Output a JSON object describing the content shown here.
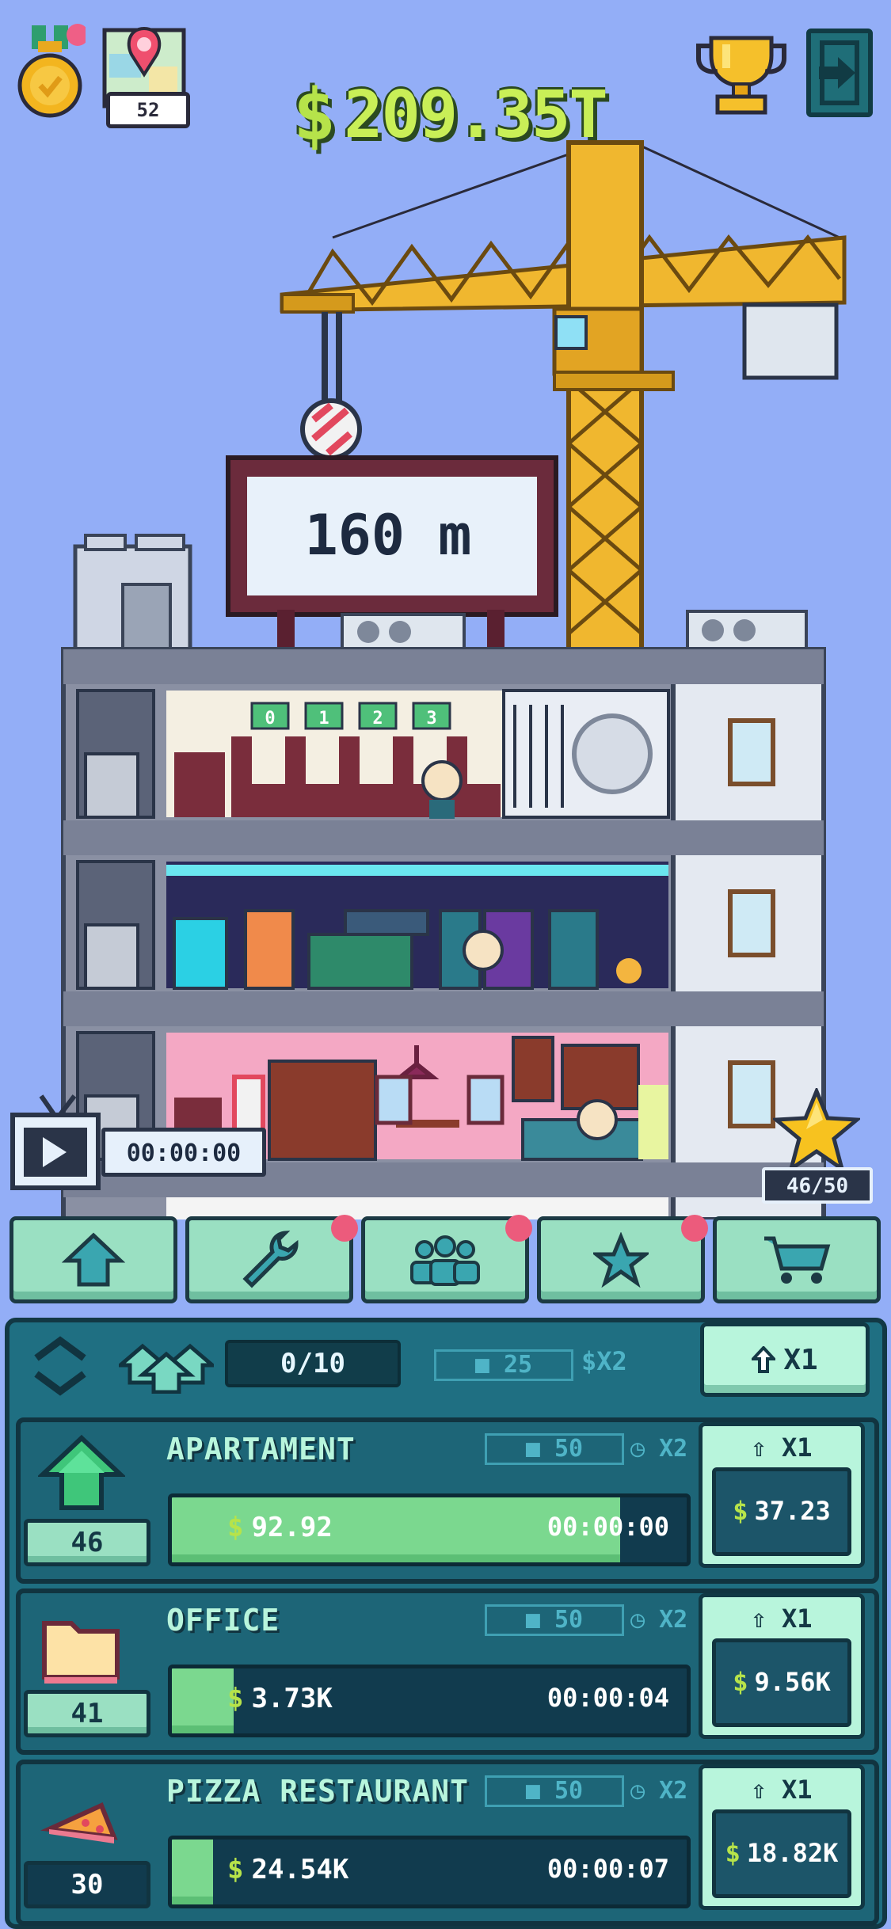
{
  "hud": {
    "map_level": "52",
    "currency_symbol": "$",
    "money": "209.35T"
  },
  "scene": {
    "billboard_text": "160 m",
    "elevator_numbers": [
      "0",
      "1",
      "2",
      "3"
    ],
    "tv_timer": "00:00:00",
    "stars": "46/50"
  },
  "nav": {
    "items": [
      {
        "name": "upgrade",
        "icon": "home-arrow-icon",
        "badge": false
      },
      {
        "name": "tools",
        "icon": "wrench-icon",
        "badge": true
      },
      {
        "name": "staff",
        "icon": "people-icon",
        "badge": true
      },
      {
        "name": "stars",
        "icon": "star-icon",
        "badge": true
      },
      {
        "name": "shop",
        "icon": "cart-icon",
        "badge": false
      }
    ]
  },
  "panel": {
    "count": "0/10",
    "lock_cost": "25",
    "multiplier": "$X2",
    "buy_multiplier": "X1"
  },
  "businesses": [
    {
      "name": "APARTAMENT",
      "lock": "50",
      "boost": "X2",
      "level": "46",
      "income": "92.92",
      "time": "00:00:00",
      "progress": 0.87,
      "buy_mult": "X1",
      "price": "37.23",
      "icon": "house-icon"
    },
    {
      "name": "OFFICE",
      "lock": "50",
      "boost": "X2",
      "level": "41",
      "income": "3.73K",
      "time": "00:00:04",
      "progress": 0.12,
      "buy_mult": "X1",
      "price": "9.56K",
      "icon": "folder-icon"
    },
    {
      "name": "PIZZA RESTAURANT",
      "lock": "50",
      "boost": "X2",
      "level": "30",
      "income": "24.54K",
      "time": "00:00:07",
      "progress": 0.08,
      "buy_mult": "X1",
      "price": "18.82K",
      "icon": "pizza-icon"
    }
  ],
  "colors": {
    "sky": "#93aef7",
    "money_green": "#c9ef57",
    "crane_yellow": "#f0b72f",
    "panel_teal": "#1f6f82",
    "mint": "#b8f5dc"
  }
}
